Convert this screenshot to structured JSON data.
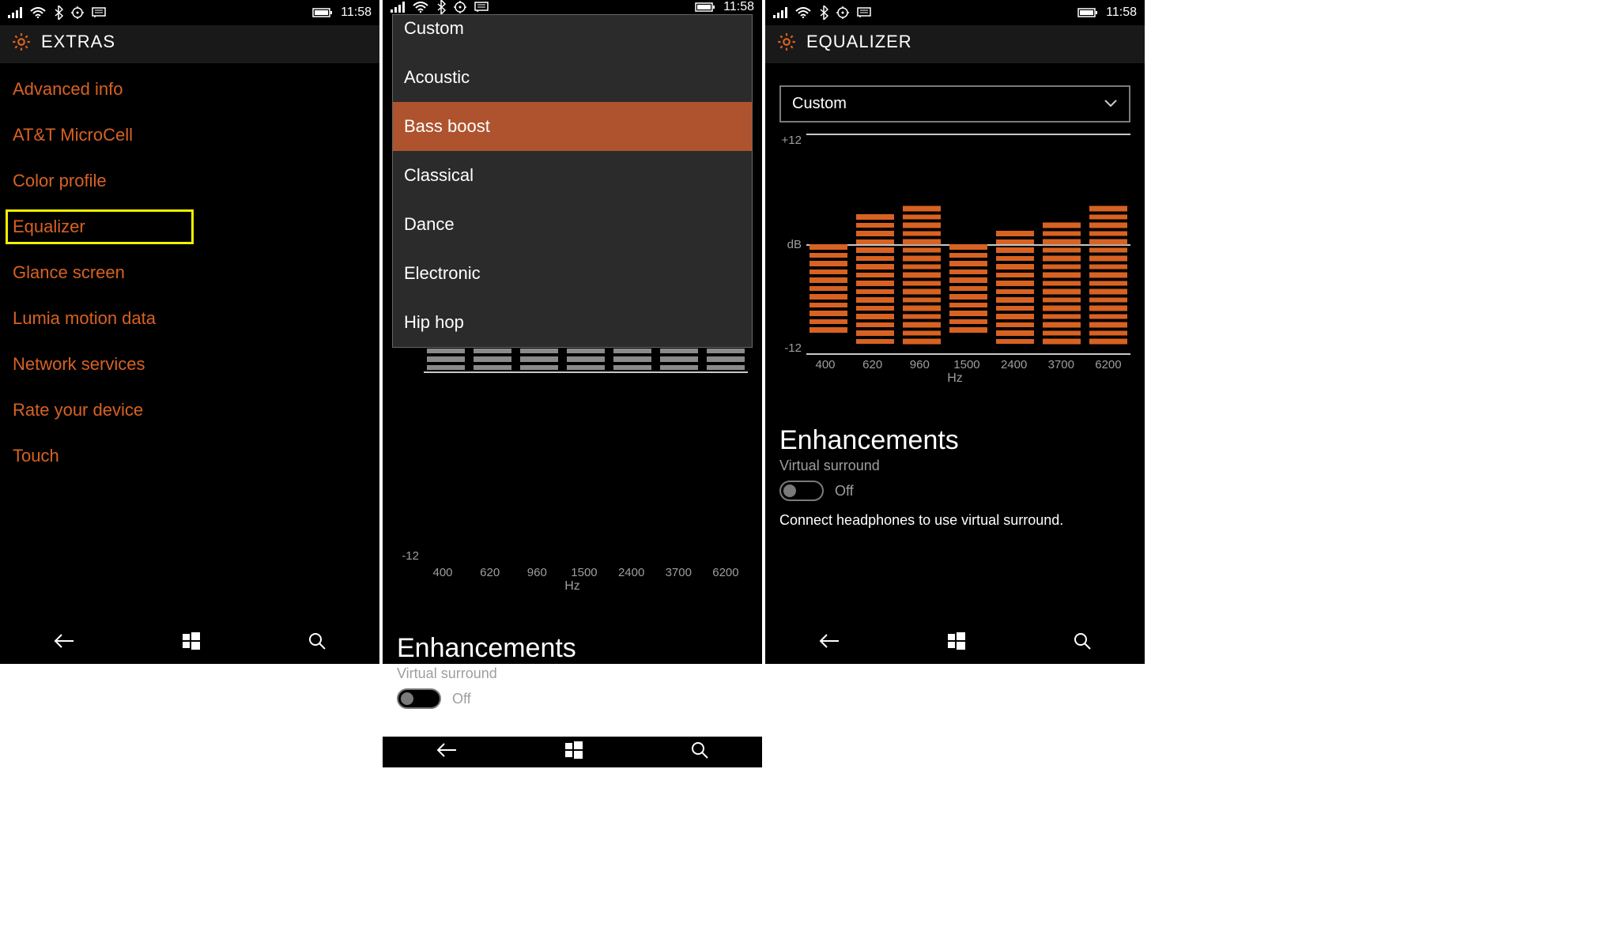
{
  "status": {
    "time": "11:58"
  },
  "screen1": {
    "title": "EXTRAS",
    "items": [
      "Advanced info",
      "AT&T MicroCell",
      "Color profile",
      "Equalizer",
      "Glance screen",
      "Lumia motion data",
      "Network services",
      "Rate your device",
      "Touch"
    ],
    "highlight_index": 3
  },
  "screen2": {
    "presets": [
      {
        "label": "Custom",
        "truncated_top": true
      },
      {
        "label": "Acoustic"
      },
      {
        "label": "Bass boost",
        "selected": true
      },
      {
        "label": "Classical"
      },
      {
        "label": "Dance"
      },
      {
        "label": "Electronic"
      },
      {
        "label": "Hip hop"
      }
    ]
  },
  "screen3": {
    "title": "EQUALIZER",
    "selected_preset": "Custom"
  },
  "eq": {
    "y_top": "+12",
    "y_mid": "dB",
    "y_bot": "-12",
    "x_unit": "Hz",
    "freqs": [
      "400",
      "620",
      "960",
      "1500",
      "2400",
      "3700",
      "6200"
    ]
  },
  "enh": {
    "heading": "Enhancements",
    "sub": "Virtual surround",
    "state": "Off",
    "hint": "Connect headphones to use virtual surround."
  },
  "chart_data": {
    "type": "bar",
    "title": "Equalizer",
    "xlabel": "Hz",
    "ylabel": "dB",
    "ylim": [
      -12,
      12
    ],
    "categories": [
      "400",
      "620",
      "960",
      "1500",
      "2400",
      "3700",
      "6200"
    ],
    "screen2_values": [
      -2,
      -2,
      -2,
      -2,
      -2,
      -2,
      -2
    ],
    "screen3_values": [
      -1,
      4,
      5,
      -1,
      2,
      3,
      5
    ]
  }
}
